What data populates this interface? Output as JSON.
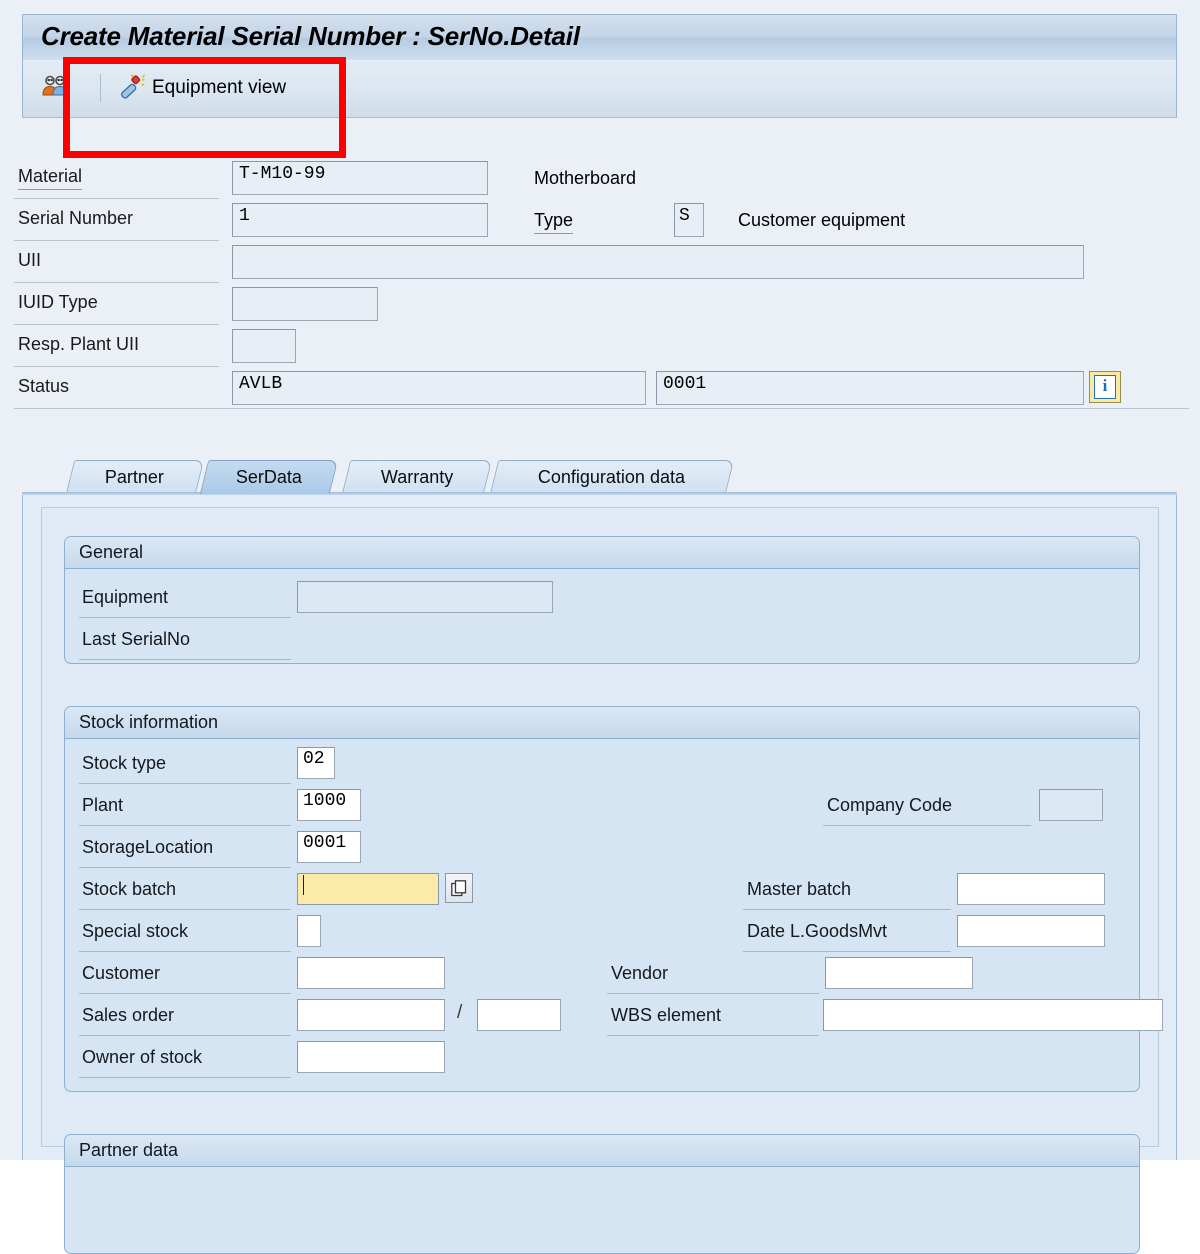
{
  "window": {
    "title": "Create Material Serial Number : SerNo.Detail"
  },
  "toolbar": {
    "partners_icon": "people-icon",
    "equipment_view_icon": "magic-wand-icon",
    "equipment_view_label": "Equipment view"
  },
  "header": {
    "material": {
      "label": "Material",
      "value": "T-M10-99",
      "description": "Motherboard"
    },
    "serial_number": {
      "label": "Serial Number",
      "value": "1"
    },
    "type": {
      "label": "Type",
      "value": "S",
      "description": "Customer equipment"
    },
    "uii": {
      "label": "UII",
      "value": ""
    },
    "iuid_type": {
      "label": "IUID Type",
      "value": ""
    },
    "resp_plant_uii": {
      "label": "Resp. Plant UII",
      "value": ""
    },
    "status": {
      "label": "Status",
      "value": "AVLB",
      "value2": "0001",
      "info_icon": "info-icon"
    }
  },
  "tabs": [
    {
      "label": "Partner",
      "active": false
    },
    {
      "label": "SerData",
      "active": true
    },
    {
      "label": "Warranty",
      "active": false
    },
    {
      "label": "Configuration data",
      "active": false
    }
  ],
  "general_group": {
    "title": "General",
    "equipment": {
      "label": "Equipment",
      "value": ""
    },
    "last_serialno": {
      "label": "Last SerialNo",
      "value": ""
    }
  },
  "stock_group": {
    "title": "Stock information",
    "stock_type": {
      "label": "Stock type",
      "value": "02"
    },
    "plant": {
      "label": "Plant",
      "value": "1000"
    },
    "company_code": {
      "label": "Company Code",
      "value": ""
    },
    "storage_location": {
      "label": "StorageLocation",
      "value": "0001"
    },
    "stock_batch": {
      "label": "Stock batch",
      "value": "",
      "focused": true,
      "help_icon": "search-help-icon"
    },
    "master_batch": {
      "label": "Master batch",
      "value": ""
    },
    "special_stock": {
      "label": "Special stock",
      "value": ""
    },
    "date_last_goods_mvt": {
      "label": "Date L.GoodsMvt",
      "value": ""
    },
    "customer": {
      "label": "Customer",
      "value": ""
    },
    "vendor": {
      "label": "Vendor",
      "value": ""
    },
    "sales_order": {
      "label": "Sales order",
      "value": "",
      "separator": "/",
      "item_value": ""
    },
    "wbs_element": {
      "label": "WBS element",
      "value": ""
    },
    "owner_of_stock": {
      "label": "Owner of stock",
      "value": ""
    }
  },
  "partner_group": {
    "title": "Partner data"
  },
  "annotation": {
    "color": "#fe0000"
  }
}
